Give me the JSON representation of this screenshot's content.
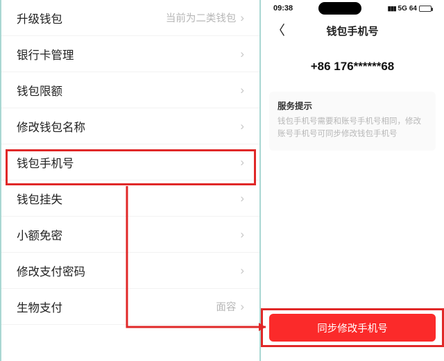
{
  "left": {
    "items": [
      {
        "label": "升级钱包",
        "value": "当前为二类钱包"
      },
      {
        "label": "银行卡管理",
        "value": ""
      },
      {
        "label": "钱包限额",
        "value": ""
      },
      {
        "label": "修改钱包名称",
        "value": ""
      },
      {
        "label": "钱包手机号",
        "value": ""
      },
      {
        "label": "钱包挂失",
        "value": ""
      },
      {
        "label": "小额免密",
        "value": ""
      },
      {
        "label": "修改支付密码",
        "value": ""
      },
      {
        "label": "生物支付",
        "value": "面容"
      }
    ]
  },
  "right": {
    "status_time": "09:38",
    "signal_label": "5G",
    "battery_label": "64",
    "nav_title": "钱包手机号",
    "phone": "+86 176******68",
    "tip_title": "服务提示",
    "tip_body": "钱包手机号需要和账号手机号相同，修改账号手机号可同步修改钱包手机号",
    "button_label": "同步修改手机号"
  }
}
